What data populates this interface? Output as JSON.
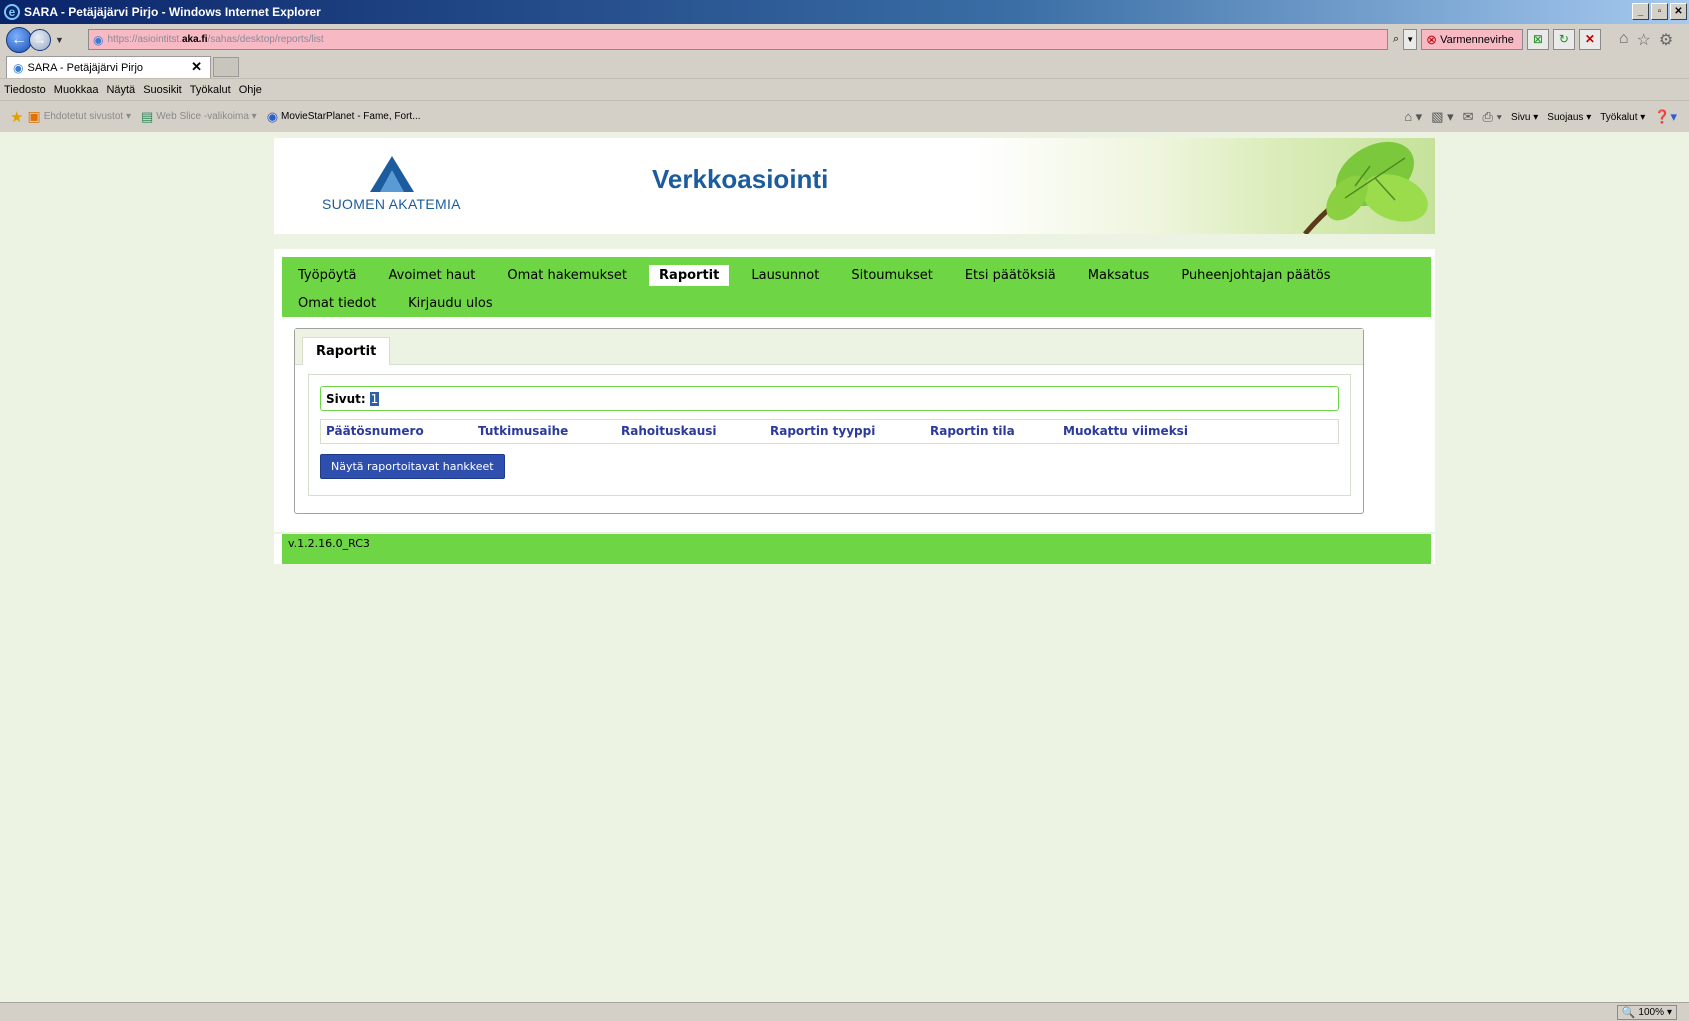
{
  "window": {
    "title": "SARA - Petäjäjärvi Pirjo - Windows Internet Explorer"
  },
  "address_bar": {
    "url_prefix": "https://asiointitst.",
    "url_host": "aka.fi",
    "url_path": "/sahas/desktop/reports/list",
    "cert_error": "Varmennevirhe"
  },
  "browser_tab": {
    "title": "SARA - Petäjäjärvi Pirjo",
    "close": "✕"
  },
  "menu": [
    "Tiedosto",
    "Muokkaa",
    "Näytä",
    "Suosikit",
    "Työkalut",
    "Ohje"
  ],
  "favorites": {
    "suggested": "Ehdotetut sivustot ▾",
    "web_slice": "Web Slice -valikoima ▾",
    "moviestar": "MovieStarPlanet - Fame, Fort..."
  },
  "commands": {
    "page": "Sivu ▾",
    "safety": "Suojaus ▾",
    "tools": "Työkalut ▾"
  },
  "header": {
    "logo_text": "SUOMEN AKATEMIA",
    "site_title": "Verkkoasiointi"
  },
  "nav": {
    "row1": [
      {
        "label": "Työpöytä",
        "active": false
      },
      {
        "label": "Avoimet haut",
        "active": false
      },
      {
        "label": "Omat hakemukset",
        "active": false
      },
      {
        "label": "Raportit",
        "active": true
      },
      {
        "label": "Lausunnot",
        "active": false
      },
      {
        "label": "Sitoumukset",
        "active": false
      },
      {
        "label": "Etsi päätöksiä",
        "active": false
      },
      {
        "label": "Maksatus",
        "active": false
      },
      {
        "label": "Puheenjohtajan päätös",
        "active": false
      }
    ],
    "row2": [
      {
        "label": "Omat tiedot",
        "active": false
      },
      {
        "label": "Kirjaudu ulos",
        "active": false
      }
    ]
  },
  "reports": {
    "tab_label": "Raportit",
    "pages_label": "Sivut:",
    "current_page": "1",
    "columns": [
      "Päätösnumero",
      "Tutkimusaihe",
      "Rahoituskausi",
      "Raportin tyyppi",
      "Raportin tila",
      "Muokattu viimeksi"
    ],
    "show_button": "Näytä raportoitavat hankkeet"
  },
  "footer": {
    "version": "v.1.2.16.0_RC3"
  },
  "status_bar": {
    "zoom": "100%"
  },
  "colors": {
    "nav_green": "#6ed544",
    "brand_blue": "#1c5c9e",
    "button_blue": "#2f4fae",
    "background": "#ecf3e3"
  }
}
